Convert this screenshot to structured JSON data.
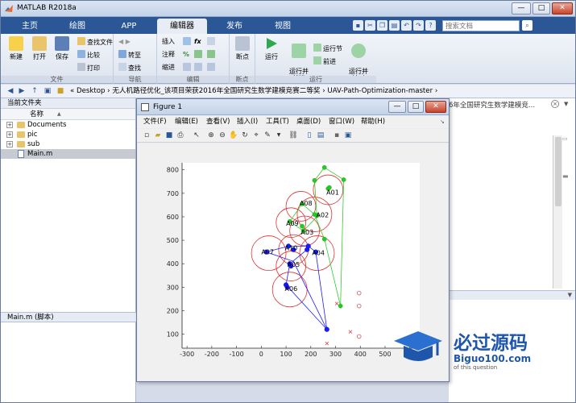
{
  "app": {
    "title": "MATLAB R2018a",
    "window_buttons": [
      "—",
      "□",
      "✕"
    ]
  },
  "tabs": [
    {
      "label": "主页",
      "active": false
    },
    {
      "label": "绘图",
      "active": false
    },
    {
      "label": "APP",
      "active": false
    },
    {
      "label": "编辑器",
      "active": true
    },
    {
      "label": "发布",
      "active": false
    },
    {
      "label": "视图",
      "active": false
    }
  ],
  "search": {
    "placeholder": "搜索文档"
  },
  "ribbon": {
    "file_group": {
      "label": "文件",
      "new": "新建",
      "open": "打开",
      "save": "保存",
      "find_files": "查找文件",
      "compare": "比较",
      "print": "打印"
    },
    "nav_group": {
      "label": "导航",
      "goto": "转至",
      "find": "查找"
    },
    "edit_group": {
      "label": "编辑",
      "insert": "插入",
      "comment": "注释",
      "indent": "缩进",
      "fx": "fx"
    },
    "breakpoint_group": {
      "label": "断点",
      "breakpoints": "断点"
    },
    "run_group": {
      "label": "运行",
      "run": "运行",
      "run_advance": "运行并\n前进",
      "run_section": "运行节",
      "advance": "前进",
      "run_time": "运行并\n计时"
    }
  },
  "address": {
    "path": "« Desktop › 无人机路径优化_该项目荣获2016年全国研究生数学建模竞赛二等奖 › UAV-Path-Optimization-master ›"
  },
  "folder_panel": {
    "header": "当前文件夹",
    "column_name": "名称",
    "sort_indicator": "▲",
    "items": [
      {
        "name": "Documents",
        "type": "folder"
      },
      {
        "name": "pic",
        "type": "folder"
      },
      {
        "name": "sub",
        "type": "folder"
      },
      {
        "name": "Main.m",
        "type": "file",
        "selected": true
      }
    ],
    "details": "Main.m  (脚本)"
  },
  "editor_area": {
    "tab_text": "6年全国研究生数学建模竞..."
  },
  "figure": {
    "title": "Figure 1",
    "menus": [
      "文件(F)",
      "编辑(E)",
      "查看(V)",
      "插入(I)",
      "工具(T)",
      "桌面(D)",
      "窗口(W)",
      "帮助(H)"
    ]
  },
  "chart_data": {
    "type": "scatter",
    "xlim": [
      -320,
      640
    ],
    "ylim": [
      40,
      830
    ],
    "xticks": [
      -300,
      -200,
      -100,
      0,
      100,
      200,
      300,
      400,
      500,
      600
    ],
    "yticks": [
      100,
      200,
      300,
      400,
      500,
      600,
      700,
      800
    ],
    "grid": false,
    "circles": [
      {
        "name": "A01",
        "cx": 270,
        "cy": 715,
        "r": 60
      },
      {
        "name": "A02",
        "cx": 215,
        "cy": 610,
        "r": 70
      },
      {
        "name": "A03",
        "cx": 175,
        "cy": 540,
        "r": 60
      },
      {
        "name": "A04",
        "cx": 225,
        "cy": 445,
        "r": 70
      },
      {
        "name": "A05",
        "cx": 120,
        "cy": 390,
        "r": 60
      },
      {
        "name": "A06",
        "cx": 115,
        "cy": 290,
        "r": 70
      },
      {
        "name": "A07",
        "cx": 30,
        "cy": 445,
        "r": 70
      },
      {
        "name": "A08",
        "cx": 160,
        "cy": 645,
        "r": 60
      },
      {
        "name": "A09",
        "cx": 120,
        "cy": 575,
        "r": 60
      },
      {
        "name": "A10",
        "cx": 130,
        "cy": 460,
        "r": 60
      }
    ],
    "labels": [
      {
        "text": "A01",
        "x": 263,
        "y": 694
      },
      {
        "text": "A02",
        "x": 222,
        "y": 598
      },
      {
        "text": "A03",
        "x": 160,
        "y": 525
      },
      {
        "text": "A04",
        "x": 205,
        "y": 437
      },
      {
        "text": "A05",
        "x": 105,
        "y": 387
      },
      {
        "text": "A06",
        "x": 95,
        "y": 284
      },
      {
        "text": "A07",
        "x": 0,
        "y": 440
      },
      {
        "text": "A08",
        "x": 155,
        "y": 648
      },
      {
        "text": "A09",
        "x": 100,
        "y": 562
      },
      {
        "text": "A10",
        "x": 95,
        "y": 458
      }
    ],
    "green_path": [
      [
        320,
        220
      ],
      [
        255,
        505
      ],
      [
        215,
        610
      ],
      [
        165,
        655
      ],
      [
        115,
        580
      ],
      [
        170,
        540
      ],
      [
        225,
        600
      ],
      [
        215,
        755
      ],
      [
        255,
        810
      ],
      [
        333,
        758
      ],
      [
        320,
        220
      ]
    ],
    "green_points": [
      [
        270,
        720
      ],
      [
        275,
        725
      ],
      [
        215,
        610
      ],
      [
        225,
        605
      ],
      [
        165,
        655
      ],
      [
        115,
        580
      ],
      [
        170,
        540
      ],
      [
        255,
        505
      ],
      [
        255,
        810
      ],
      [
        333,
        758
      ],
      [
        320,
        220
      ],
      [
        215,
        755
      ],
      [
        165,
        560
      ]
    ],
    "blue_path": [
      [
        265,
        120
      ],
      [
        130,
        410
      ],
      [
        20,
        450
      ],
      [
        110,
        475
      ],
      [
        190,
        475
      ],
      [
        220,
        450
      ],
      [
        265,
        120
      ],
      [
        100,
        310
      ],
      [
        115,
        400
      ],
      [
        185,
        460
      ]
    ],
    "blue_points": [
      [
        20,
        450
      ],
      [
        110,
        475
      ],
      [
        130,
        460
      ],
      [
        185,
        460
      ],
      [
        190,
        475
      ],
      [
        220,
        450
      ],
      [
        115,
        400
      ],
      [
        120,
        390
      ],
      [
        100,
        310
      ],
      [
        105,
        300
      ],
      [
        265,
        120
      ]
    ],
    "red_circles": [
      [
        395,
        275
      ],
      [
        395,
        220
      ],
      [
        395,
        90
      ]
    ],
    "red_x": [
      [
        305,
        230
      ],
      [
        360,
        110
      ],
      [
        265,
        60
      ]
    ]
  },
  "watermark": {
    "text": "必过源码",
    "url": "Biguo100.com",
    "tagline": "of this question"
  }
}
